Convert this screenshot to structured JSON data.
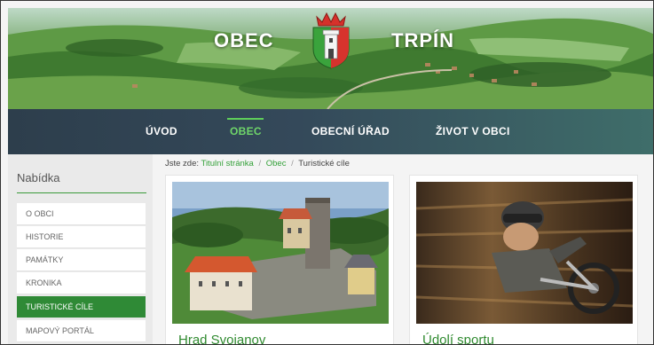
{
  "header": {
    "title_left": "OBEC",
    "title_right": "TRPÍN",
    "coat_of_arms_icon": "coat-of-arms-icon"
  },
  "nav": {
    "items": [
      {
        "label": "ÚVOD",
        "active": false
      },
      {
        "label": "OBEC",
        "active": true
      },
      {
        "label": "OBECNÍ ÚŘAD",
        "active": false
      },
      {
        "label": "ŽIVOT V OBCI",
        "active": false
      }
    ]
  },
  "sidebar": {
    "title": "Nabídka",
    "items": [
      {
        "label": "O OBCI",
        "active": false
      },
      {
        "label": "HISTORIE",
        "active": false
      },
      {
        "label": "PAMÁTKY",
        "active": false
      },
      {
        "label": "KRONIKA",
        "active": false
      },
      {
        "label": "TURISTICKÉ CÍLE",
        "active": true
      },
      {
        "label": "MAPOVÝ PORTÁL",
        "active": false
      }
    ]
  },
  "breadcrumb": {
    "prefix": "Jste zde:",
    "links": [
      "Titulní stránka",
      "Obec"
    ],
    "current": "Turistické cíle",
    "separator": "/"
  },
  "cards": [
    {
      "title": "Hrad Svojanov",
      "image": "castle-photo"
    },
    {
      "title": "Údolí sportu",
      "image": "mountain-biker-photo"
    }
  ],
  "colors": {
    "accent_green": "#2f8a36",
    "nav_bg": "#2d3e4c",
    "link_green": "#35a13a"
  }
}
